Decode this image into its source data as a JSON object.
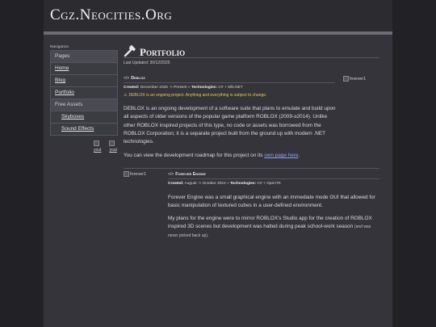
{
  "site": {
    "title": "Cgz.Neocities.Org"
  },
  "nav": {
    "caption": "Navigation",
    "items": [
      {
        "label": "Pages",
        "kind": "plain"
      },
      {
        "label": "Home",
        "kind": "link"
      },
      {
        "label": "Blog",
        "kind": "link"
      },
      {
        "label": "Portfolio",
        "kind": "link"
      },
      {
        "label": "Free Assets",
        "kind": "plain"
      },
      {
        "label": "Skyboxes",
        "kind": "sub"
      },
      {
        "label": "Sound Effects",
        "kind": "sub"
      }
    ],
    "badges": [
      "yout",
      "yout"
    ]
  },
  "main": {
    "title": "Portfolio",
    "title_icon": "hammer-icon",
    "updated": "Last Updated: 30/12/2025",
    "projects": [
      {
        "name": "Deblox",
        "created_label": "Created:",
        "created": "December 2025 -> Present",
        "tech_label": "Technologies:",
        "tech": "C# + Silk.NET",
        "sep": "»",
        "warning": "DEBLOX is an ongoing project. Anything and everything is subject to change.",
        "paragraph1": "DEBLOX is an ongoing development of a software suite that plans to emulate and build upon all aspects of older versions of the popular game platform ROBLOX (2009-≥2014). Unlike other ROBLOX inspired projects of this type, no code or assets was borrowed from the ROBLOX Corporation; it is a separate project built from the ground up with modern .NET technologies.",
        "paragraph2_prefix": "You can view the development roadmap for this project on its ",
        "paragraph2_link": "own page here",
        "paragraph2_suffix": ".",
        "image_alt": "forever1"
      },
      {
        "name": "Forever Engine",
        "created_label": "Created:",
        "created": "August -> October 2024",
        "tech_label": "Technologies:",
        "tech": "C# + OpenTK",
        "sep": "»",
        "paragraph1": "Forever Engine was a small graphical engine with an immediate mode GUI that allowed for basic manipulation of textured cubes in a user-defined environment.",
        "paragraph2": "My plans for the engine were to mirror ROBLOX's Studio app for the creation of ROBLOX inspired 3D scenes but development was halted during peak school-work season",
        "paragraph2_small": "(and was never picked back up).",
        "image_alt": "forever1"
      }
    ]
  },
  "colors": {
    "background": "#212126",
    "panel": "#34343a",
    "link": "#8fa0ff",
    "warning": "#e3c85a"
  }
}
